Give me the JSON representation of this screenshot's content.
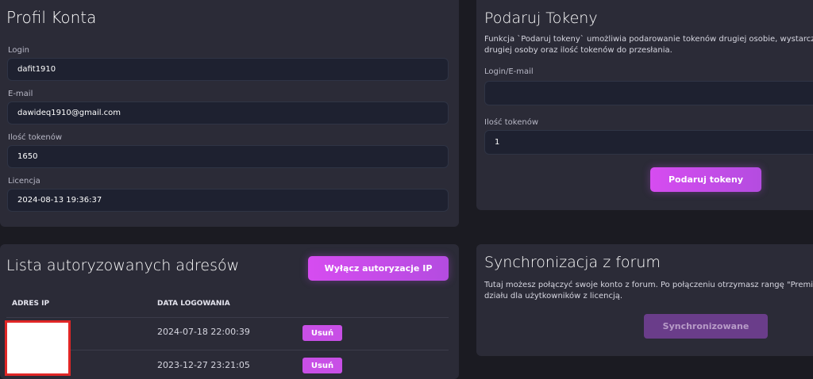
{
  "profile": {
    "title": "Profil Konta",
    "fields": [
      {
        "label": "Login",
        "value": "dafit1910"
      },
      {
        "label": "E-mail",
        "value": "dawideq1910@gmail.com"
      },
      {
        "label": "Ilość tokenów",
        "value": "1650"
      },
      {
        "label": "Licencja",
        "value": "2024-08-13 19:36:37"
      }
    ]
  },
  "gift": {
    "title": "Podaruj Tokeny",
    "description_line1": "Funkcja `Podaruj tokeny` umożliwia podarowanie tokenów drugiej osobie, wystarczy po",
    "description_line2": "drugiej osoby oraz ilość tokenów do przesłania.",
    "login_label": "Login/E-mail",
    "login_value": "",
    "amount_label": "Ilość tokenów",
    "amount_value": "1",
    "submit_label": "Podaruj tokeny"
  },
  "addresses": {
    "title": "Lista autoryzowanych adresów",
    "disable_button_label": "Wyłącz autoryzacje IP",
    "columns": [
      "ADRES IP",
      "DATA LOGOWANIA"
    ],
    "rows": [
      {
        "date": "2024-07-18 22:00:39",
        "action": "Usuń"
      },
      {
        "date": "2023-12-27 23:21:05",
        "action": "Usuń"
      }
    ]
  },
  "forum": {
    "title": "Synchronizacja z forum",
    "description_line1": "Tutaj możesz połączyć swoje konto z forum. Po połączeniu otrzymasz rangę \"Premium\"",
    "description_line2": "działu dla użytkowników z licencją.",
    "button_label": "Synchronizowane"
  },
  "colors": {
    "background": "#1b1b22",
    "card": "#2b2b37",
    "input": "#1e2130",
    "accent": "#c84fe6",
    "redaction_border": "#e02626"
  }
}
